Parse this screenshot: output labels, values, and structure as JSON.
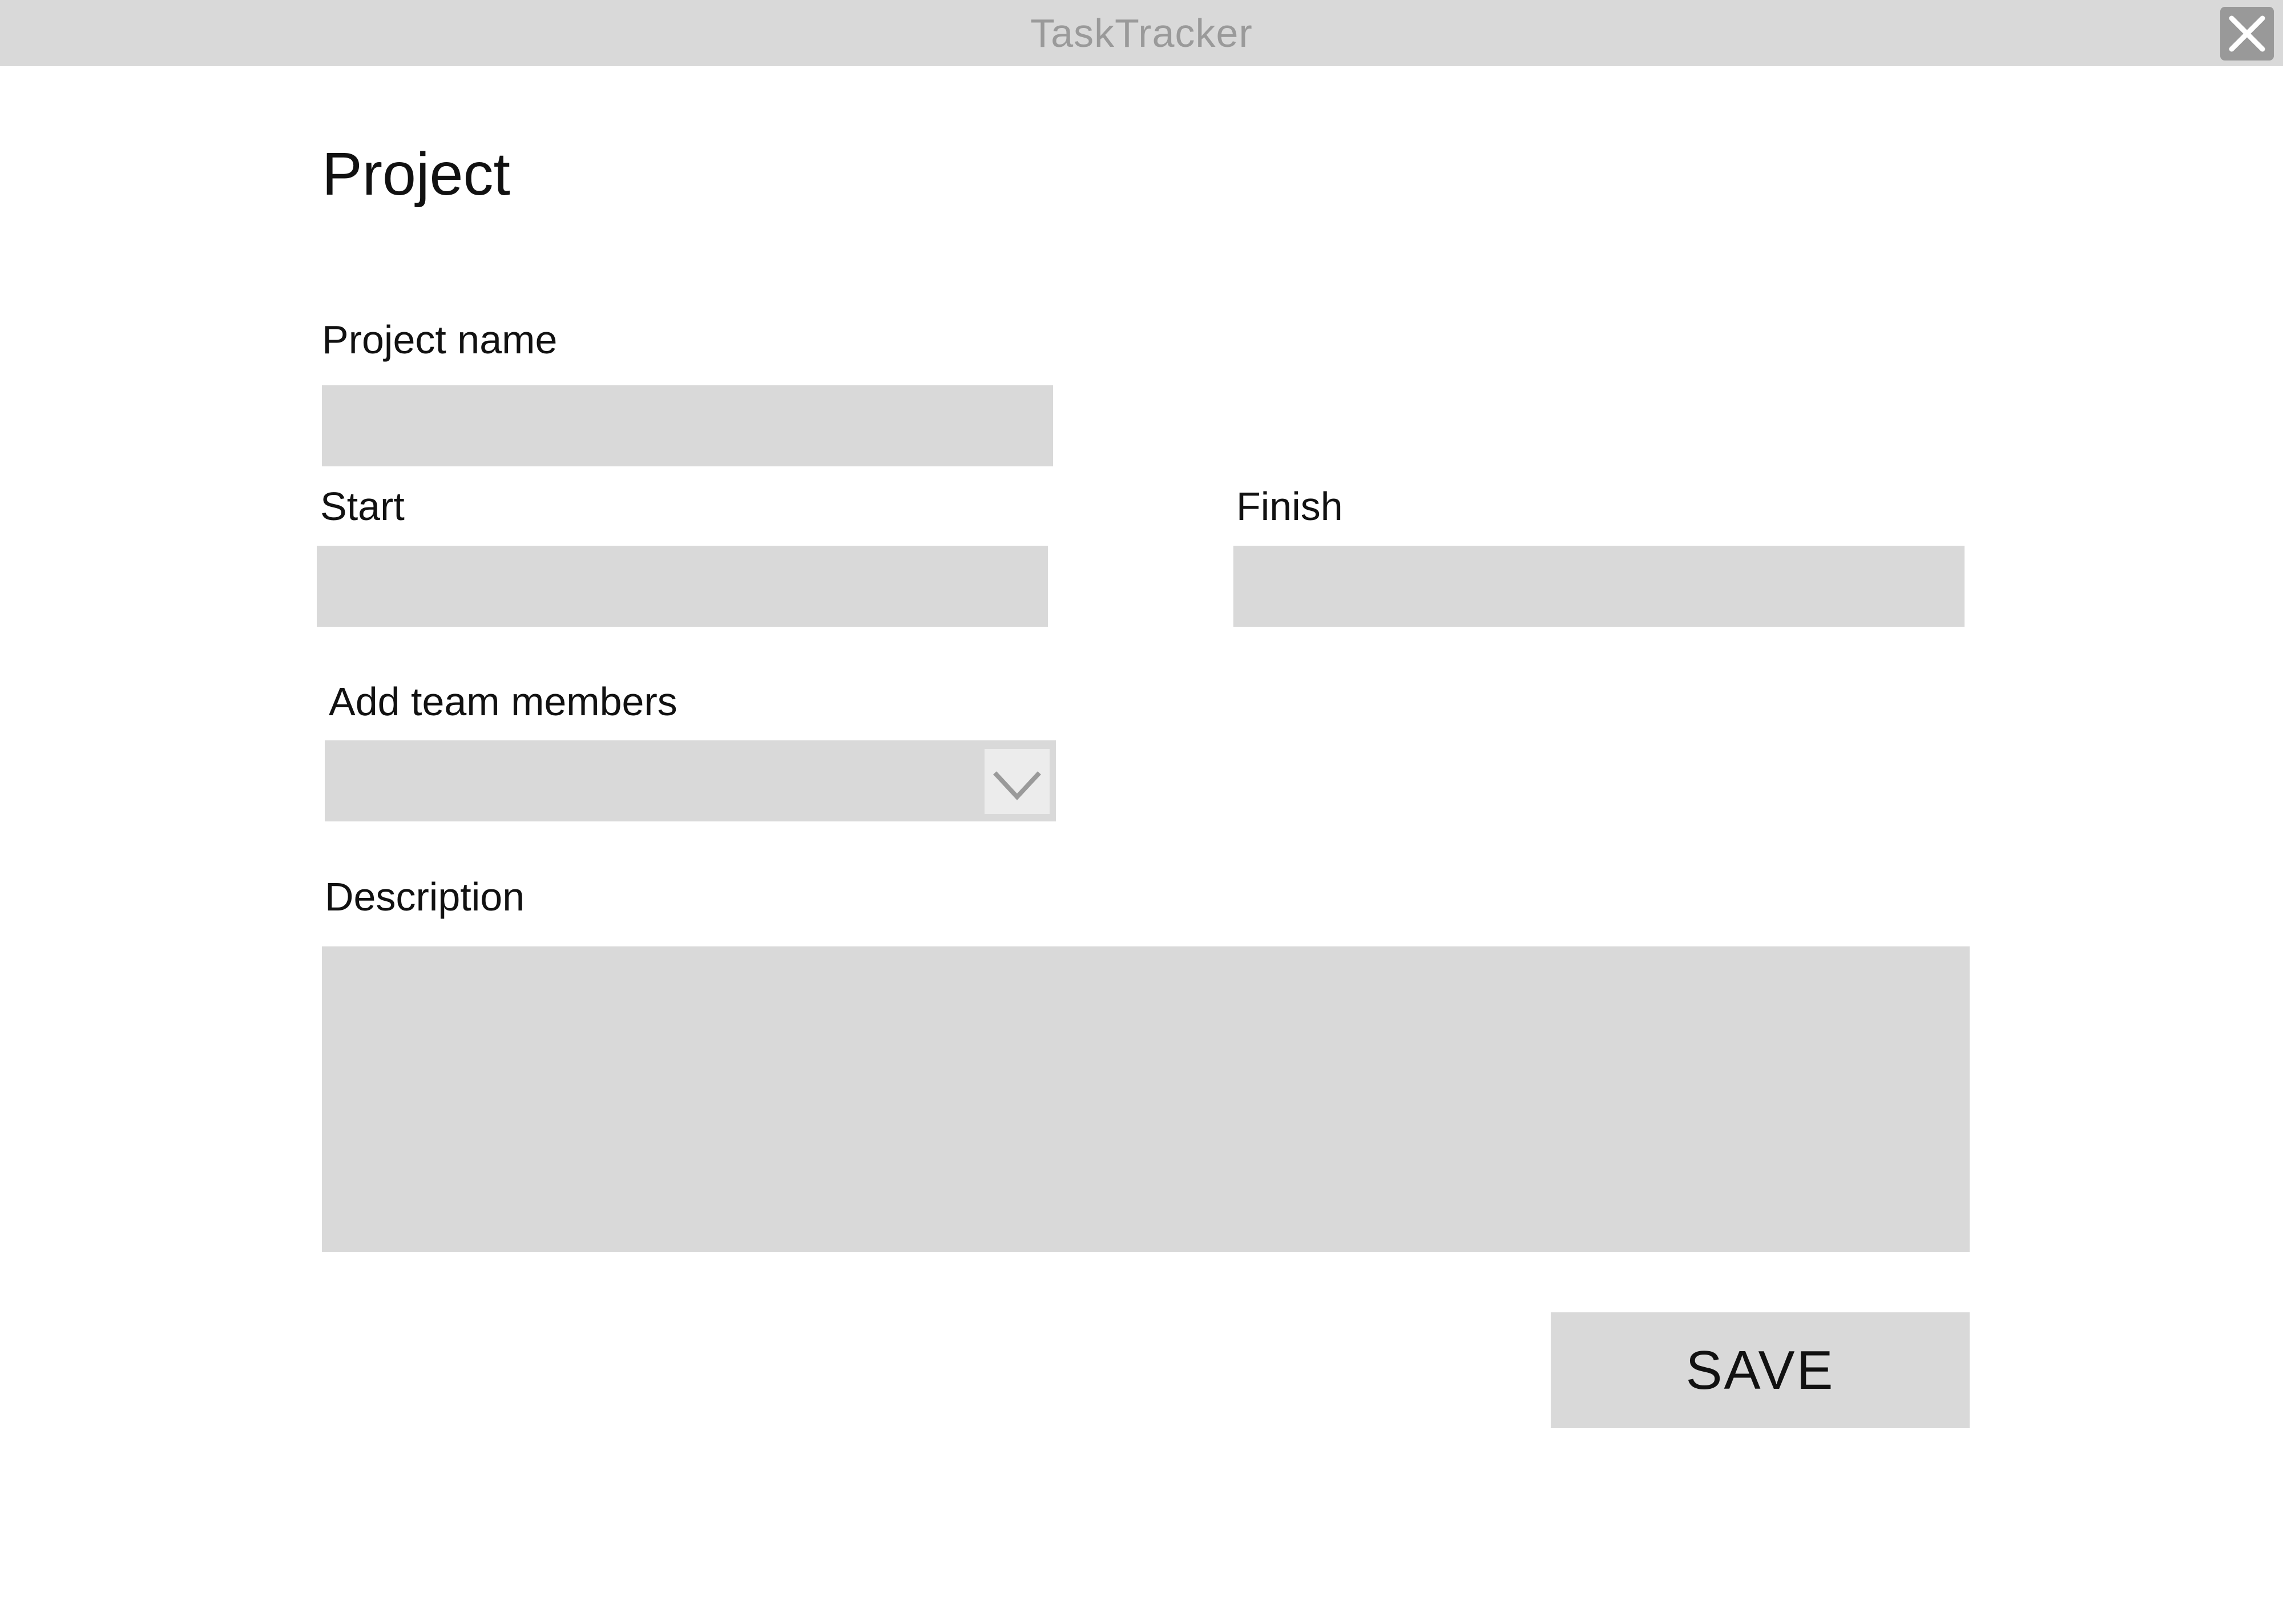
{
  "window": {
    "title": "TaskTracker",
    "close_icon": "close-icon"
  },
  "form": {
    "heading": "Project",
    "project_name": {
      "label": "Project name",
      "value": "",
      "placeholder": ""
    },
    "start": {
      "label": "Start",
      "value": "",
      "placeholder": ""
    },
    "finish": {
      "label": "Finish",
      "value": "",
      "placeholder": ""
    },
    "team_members": {
      "label": "Add team members",
      "selected": "",
      "icon": "chevron-down-icon"
    },
    "description": {
      "label": "Description",
      "value": "",
      "placeholder": ""
    },
    "save_label": "SAVE"
  },
  "colors": {
    "titlebar": "#d9d9d9",
    "field_background": "#d9d9d9",
    "close_button": "#999999",
    "title_text": "#9a9a9a"
  }
}
